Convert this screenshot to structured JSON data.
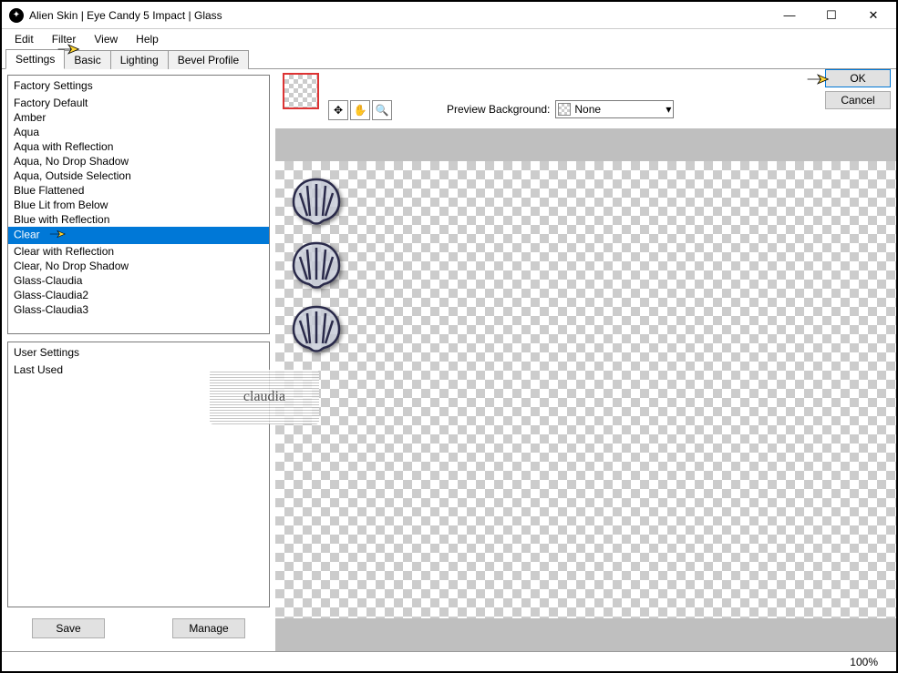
{
  "window": {
    "title": "Alien Skin | Eye Candy 5 Impact | Glass"
  },
  "menu": {
    "edit": "Edit",
    "filter": "Filter",
    "view": "View",
    "help": "Help"
  },
  "tabs": {
    "settings": "Settings",
    "basic": "Basic",
    "lighting": "Lighting",
    "bevel_profile": "Bevel Profile"
  },
  "factory": {
    "header": "Factory Settings",
    "items": [
      "Factory Default",
      "Amber",
      "Aqua",
      "Aqua with Reflection",
      "Aqua, No Drop Shadow",
      "Aqua, Outside Selection",
      "Blue Flattened",
      "Blue Lit from Below",
      "Blue with Reflection",
      "Clear",
      "Clear with Reflection",
      "Clear, No Drop Shadow",
      "Glass-Claudia",
      "Glass-Claudia2",
      "Glass-Claudia3"
    ],
    "selected_index": 9
  },
  "user": {
    "header": "User Settings",
    "items": [
      "Last Used"
    ]
  },
  "buttons": {
    "save": "Save",
    "manage": "Manage",
    "ok": "OK",
    "cancel": "Cancel"
  },
  "preview": {
    "label": "Preview Background:",
    "selected": "None"
  },
  "status": {
    "zoom": "100%"
  },
  "watermark": "claudia"
}
